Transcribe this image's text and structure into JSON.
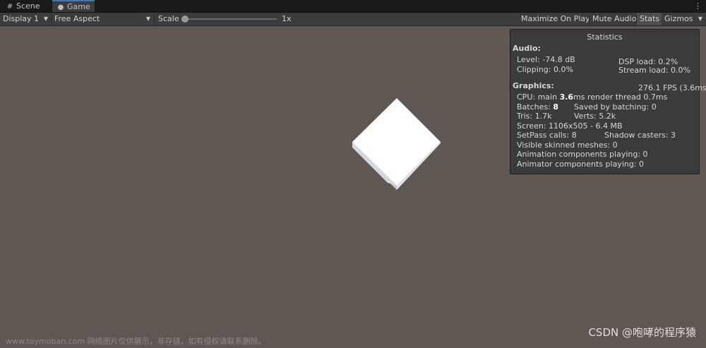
{
  "tabs": {
    "scene": "Scene",
    "game": "Game",
    "menu_icon": "kebab-menu-icon"
  },
  "toolbar": {
    "display": "Display 1",
    "aspect": "Free Aspect",
    "scale_label": "Scale",
    "scale_value": "1x",
    "scale_level": 0.0,
    "maximize": "Maximize On Play",
    "mute": "Mute Audio",
    "stats": "Stats",
    "gizmos": "Gizmos"
  },
  "stats": {
    "title": "Statistics",
    "audio_header": "Audio:",
    "level": "Level: -74.8 dB",
    "dsp": "DSP load: 0.2%",
    "clipping": "Clipping: 0.0%",
    "stream": "Stream load: 0.0%",
    "graphics_header": "Graphics:",
    "fps": "276.1 FPS (3.6ms)",
    "cpu_prefix": "CPU: main ",
    "cpu_main": "3.6",
    "cpu_suffix": "ms  render thread 0.7ms",
    "batches_prefix": "Batches: ",
    "batches": "8",
    "saved": "Saved by batching: 0",
    "tris": "Tris: 1.7k",
    "verts": "Verts: 5.2k",
    "screen": "Screen: 1106x505 - 6.4 MB",
    "setpass": "SetPass calls: 8",
    "shadow": "Shadow casters: 3",
    "skinned": "Visible skinned meshes: 0",
    "anim": "Animation components playing: 0",
    "animator": "Animator components playing: 0"
  },
  "watermark": {
    "left": "www.toymoban.com 网络图片仅供展示，非存储，如有侵权请联系删除。",
    "right": "CSDN @咆哮的程序猿"
  },
  "colors": {
    "background": "#5f5752",
    "panel": "#3b3b3b",
    "toolbar": "#3c3c3c",
    "accent": "#3a79bb"
  }
}
